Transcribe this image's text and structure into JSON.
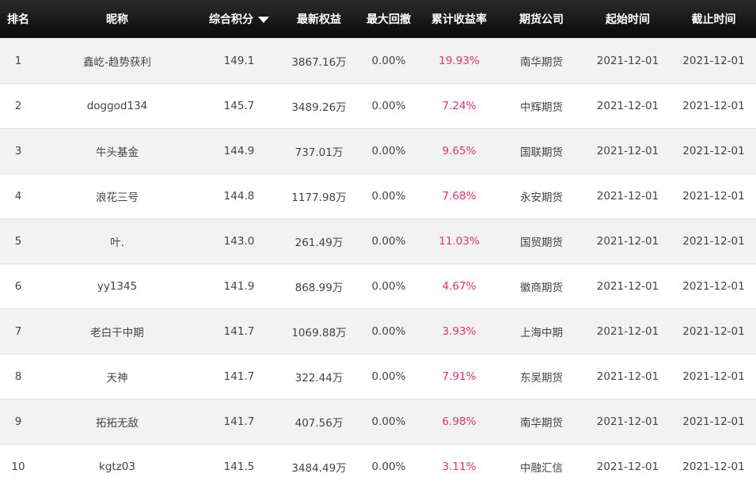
{
  "header": {
    "rank": "排名",
    "nickname": "昵称",
    "score": "综合积分",
    "equity": "最新权益",
    "max_drawdown": "最大回撤",
    "cum_return": "累计收益率",
    "broker": "期货公司",
    "start_time": "起始时间",
    "end_time": "截止时间",
    "sort_icon": "sort-desc-icon"
  },
  "colors": {
    "header_bg": "#111111",
    "return_text": "#e8336d",
    "stripe": "#f2f2f2"
  },
  "rows": [
    {
      "rank": "1",
      "nickname": "鑫屹-趋势获利",
      "score": "149.1",
      "equity": "3867.16万",
      "max_drawdown": "0.00%",
      "cum_return": "19.93%",
      "broker": "南华期货",
      "start": "2021-12-01",
      "end": "2021-12-01"
    },
    {
      "rank": "2",
      "nickname": "doggod134",
      "score": "145.7",
      "equity": "3489.26万",
      "max_drawdown": "0.00%",
      "cum_return": "7.24%",
      "broker": "中辉期货",
      "start": "2021-12-01",
      "end": "2021-12-01"
    },
    {
      "rank": "3",
      "nickname": "牛头基金",
      "score": "144.9",
      "equity": "737.01万",
      "max_drawdown": "0.00%",
      "cum_return": "9.65%",
      "broker": "国联期货",
      "start": "2021-12-01",
      "end": "2021-12-01"
    },
    {
      "rank": "4",
      "nickname": "浪花三号",
      "score": "144.8",
      "equity": "1177.98万",
      "max_drawdown": "0.00%",
      "cum_return": "7.68%",
      "broker": "永安期货",
      "start": "2021-12-01",
      "end": "2021-12-01"
    },
    {
      "rank": "5",
      "nickname": "叶.",
      "score": "143.0",
      "equity": "261.49万",
      "max_drawdown": "0.00%",
      "cum_return": "11.03%",
      "broker": "国贸期货",
      "start": "2021-12-01",
      "end": "2021-12-01"
    },
    {
      "rank": "6",
      "nickname": "yy1345",
      "score": "141.9",
      "equity": "868.99万",
      "max_drawdown": "0.00%",
      "cum_return": "4.67%",
      "broker": "徽商期货",
      "start": "2021-12-01",
      "end": "2021-12-01"
    },
    {
      "rank": "7",
      "nickname": "老白干中期",
      "score": "141.7",
      "equity": "1069.88万",
      "max_drawdown": "0.00%",
      "cum_return": "3.93%",
      "broker": "上海中期",
      "start": "2021-12-01",
      "end": "2021-12-01"
    },
    {
      "rank": "8",
      "nickname": "天神",
      "score": "141.7",
      "equity": "322.44万",
      "max_drawdown": "0.00%",
      "cum_return": "7.91%",
      "broker": "东吴期货",
      "start": "2021-12-01",
      "end": "2021-12-01"
    },
    {
      "rank": "9",
      "nickname": "拓拓无敌",
      "score": "141.7",
      "equity": "407.56万",
      "max_drawdown": "0.00%",
      "cum_return": "6.98%",
      "broker": "南华期货",
      "start": "2021-12-01",
      "end": "2021-12-01"
    },
    {
      "rank": "10",
      "nickname": "kgtz03",
      "score": "141.5",
      "equity": "3484.49万",
      "max_drawdown": "0.00%",
      "cum_return": "3.11%",
      "broker": "中融汇信",
      "start": "2021-12-01",
      "end": "2021-12-01"
    }
  ]
}
